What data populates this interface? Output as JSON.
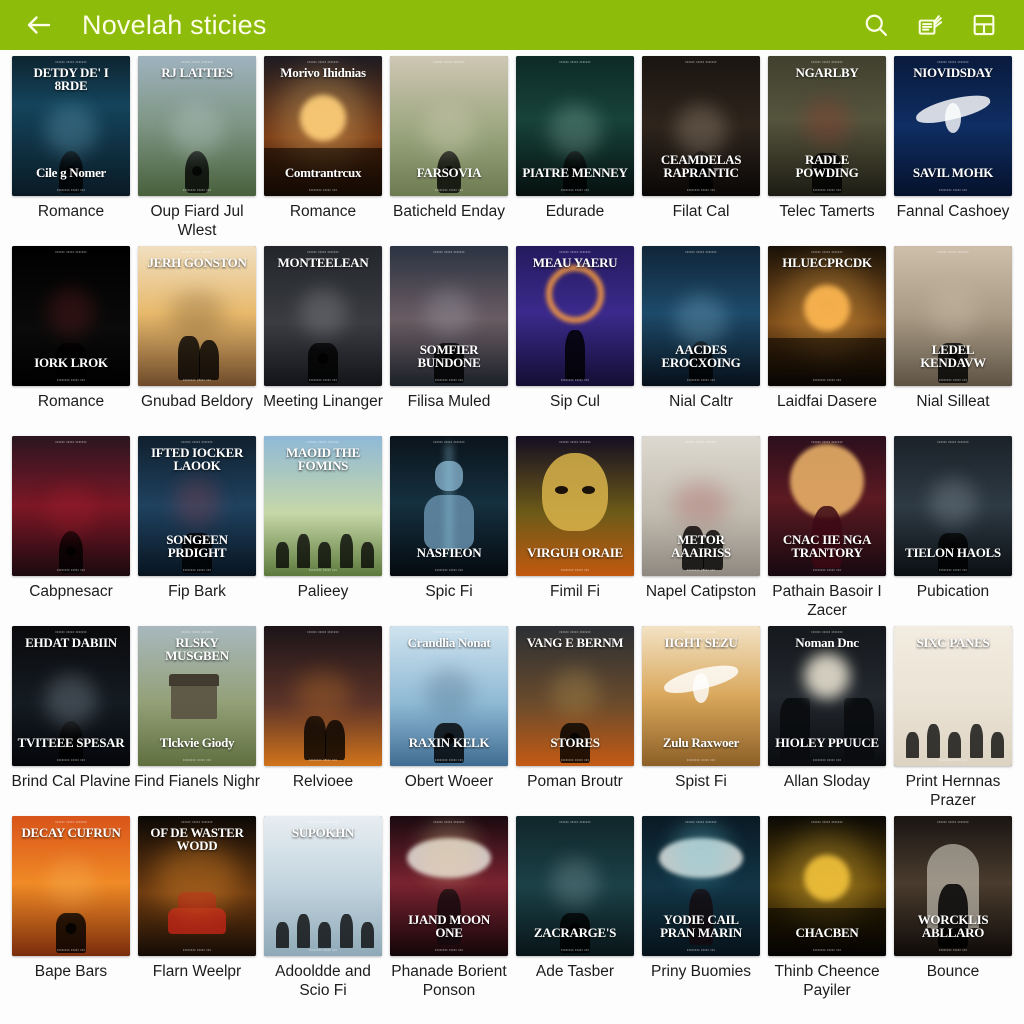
{
  "app_bar": {
    "back_icon": "arrow-left-icon",
    "title": "Novelah sticies",
    "actions": [
      {
        "name": "search-icon",
        "label": "Search"
      },
      {
        "name": "bookshelf-icon",
        "label": "Library"
      },
      {
        "name": "book-icon",
        "label": "Reader"
      }
    ],
    "background_color": "#8dbc0a",
    "title_color": "#fdfee8"
  },
  "grid": {
    "columns": 8,
    "rows": 5,
    "background_color": "#fdfdfd",
    "items": [
      {
        "label": "Romance",
        "cover_title_top": "DETDY DE' I 8RDE",
        "cover_title_bottom": "Cile g Nomer",
        "bg": "linear-gradient(180deg,#0d2430 0%,#14445c 35%,#0a1a24 100%)",
        "accent": "#8fd4f0",
        "figure": "woman"
      },
      {
        "label": "Oup Fiard Jul Wlest",
        "cover_title_top": "RJ LATTIES",
        "cover_title_bottom": "",
        "bg": "linear-gradient(180deg,#9fb3bf 0%,#7e9685 48%,#49603c 100%)",
        "accent": "#d8e5ea",
        "figure": "woman"
      },
      {
        "label": "Romance",
        "cover_title_top": "Morivo Ihidnіas",
        "cover_title_bottom": "Comtrantrcux",
        "bg": "linear-gradient(180deg,#1d1b22 0%,#7a3c16 58%,#2a1508 100%)",
        "accent": "#ffd07a",
        "figure": "sun"
      },
      {
        "label": "Baticheld Enday",
        "cover_title_top": "",
        "cover_title_bottom": "FARSOVIA",
        "bg": "linear-gradient(180deg,#cfc7b4 0%,#9aa57e 55%,#6d7b51 100%)",
        "accent": "#e8e2cf",
        "figure": "woman"
      },
      {
        "label": "Edurade",
        "cover_title_top": "",
        "cover_title_bottom": "PIATRE MENNEY",
        "bg": "linear-gradient(180deg,#0e2a26 0%,#17433a 45%,#06100f 100%)",
        "accent": "#b6e3d4",
        "figure": "woman"
      },
      {
        "label": "Filat Cal",
        "cover_title_top": "",
        "cover_title_bottom": "CEAMDELAS RAPRANTIC",
        "bg": "linear-gradient(180deg,#1a1510 0%,#2e241c 50%,#090706 100%)",
        "accent": "#e3cdb4",
        "figure": "woman"
      },
      {
        "label": "Telec Tamerts",
        "cover_title_top": "NGARLBY",
        "cover_title_bottom": "RADLE POWDING",
        "bg": "linear-gradient(180deg,#41402f 0%,#55553d 45%,#1d1c14 100%)",
        "accent": "#c3302c",
        "figure": "man"
      },
      {
        "label": "Fannal Cashoey",
        "cover_title_top": "NIOVIDSDAY",
        "cover_title_bottom": "SAVIL MOHK",
        "bg": "linear-gradient(180deg,#091a3d 0%,#0f2e63 50%,#05112b 100%)",
        "accent": "#e8c349",
        "figure": "bird"
      },
      {
        "label": "Romance",
        "cover_title_top": "",
        "cover_title_bottom": "IORK LROK",
        "bg": "linear-gradient(180deg,#000000 0%,#0a0a0a 60%,#000000 100%)",
        "accent": "#b83235",
        "figure": "man"
      },
      {
        "label": "Gnubad Beldory",
        "cover_title_top": "JERH GONSTON",
        "cover_title_bottom": "",
        "bg": "linear-gradient(180deg,#f0dfc0 0%,#e8b96c 48%,#6d4a2a 100%)",
        "accent": "#3a2a18",
        "figure": "couple"
      },
      {
        "label": "Meeting Linanger",
        "cover_title_top": "MONTEELEAN",
        "cover_title_bottom": "",
        "bg": "linear-gradient(180deg,#23262b 0%,#3a3c42 55%,#121418 100%)",
        "accent": "#d9d9d9",
        "figure": "man"
      },
      {
        "label": "Filisa Muled",
        "cover_title_top": "",
        "cover_title_bottom": "SOMFIER BUNDONE",
        "bg": "linear-gradient(180deg,#2b3342 0%,#6a5c63 52%,#1b2028 100%)",
        "accent": "#cfd6e0",
        "figure": "man"
      },
      {
        "label": "Sip Cul",
        "cover_title_top": "MEAU YAERU",
        "cover_title_bottom": "",
        "bg": "linear-gradient(180deg,#241a5e 0%,#3b2a8c 48%,#130e33 100%)",
        "accent": "#ff9f3c",
        "figure": "magic"
      },
      {
        "label": "Nial Caltr",
        "cover_title_top": "",
        "cover_title_bottom": "AACDES EROCXOING",
        "bg": "linear-gradient(180deg,#102538 0%,#1d4a6a 48%,#071019 100%)",
        "accent": "#9fd6ef",
        "figure": "woman"
      },
      {
        "label": "Laidfai Dasere",
        "cover_title_top": "HLUECPRCDK",
        "cover_title_bottom": "",
        "bg": "linear-gradient(180deg,#1a1208 0%,#7a4a18 55%,#140c05 100%)",
        "accent": "#ffb851",
        "figure": "sun"
      },
      {
        "label": "Nial Silleat",
        "cover_title_top": "",
        "cover_title_bottom": "LEDEL KENDAVW",
        "bg": "linear-gradient(180deg,#cdbfa9 0%,#a99a85 50%,#5d5344 100%)",
        "accent": "#e4d8c4",
        "figure": "man"
      },
      {
        "label": "Cabpnesacr",
        "cover_title_top": "",
        "cover_title_bottom": "",
        "bg": "linear-gradient(180deg,#2a1620 0%,#7d1726 50%,#1a0a0f 100%)",
        "accent": "#b3202e",
        "figure": "woman"
      },
      {
        "label": "Fip Bark",
        "cover_title_top": "IFTED IOCKER LAOOK",
        "cover_title_bottom": "SONGEEN PRDIGHT",
        "bg": "linear-gradient(180deg,#10202e 0%,#1f4260 50%,#081420 100%)",
        "accent": "#d9434a",
        "figure": "man"
      },
      {
        "label": "Palieey",
        "cover_title_top": "MAOID THE FOMINS",
        "cover_title_bottom": "",
        "bg": "linear-gradient(180deg,#8fb9d8 0%,#c6d7a8 55%,#5d7a3c 100%)",
        "accent": "#e4453f",
        "figure": "crowd"
      },
      {
        "label": "Spic Fi",
        "cover_title_top": "",
        "cover_title_bottom": "NASFIEON",
        "bg": "linear-gradient(180deg,#0b141c 0%,#15303f 48%,#050a10 100%)",
        "accent": "#9fdcf2",
        "figure": "robot"
      },
      {
        "label": "Fimil Fi",
        "cover_title_top": "",
        "cover_title_bottom": "VIRGUH ORAIE",
        "bg": "linear-gradient(180deg,#140d22 0%,#6d5a18 55%,#c2590f 100%)",
        "accent": "#d9b44a",
        "figure": "face"
      },
      {
        "label": "Napel Catipston",
        "cover_title_top": "",
        "cover_title_bottom": "METOR AAAIRISS",
        "bg": "linear-gradient(180deg,#ddd9d0 0%,#c2bcb0 55%,#8e8880 100%)",
        "accent": "#9c2530",
        "figure": "couple"
      },
      {
        "label": "Pathain Basoir I Zacer",
        "cover_title_top": "",
        "cover_title_bottom": "CNAC IIE NGA TRANTORY",
        "bg": "linear-gradient(180deg,#2b0f1c 0%,#5c1a22 45%,#170810 100%)",
        "accent": "#f0b86b",
        "figure": "moon"
      },
      {
        "label": "Pubication",
        "cover_title_top": "",
        "cover_title_bottom": "TIELON HAOLS",
        "bg": "linear-gradient(180deg,#1b2229 0%,#2e3a44 50%,#0b0f13 100%)",
        "accent": "#d6e2ea",
        "figure": "man"
      },
      {
        "label": "Brind Cal Plavine",
        "cover_title_top": "EHDAT DABIIN",
        "cover_title_bottom": "TVITEEE SPESAR",
        "bg": "linear-gradient(180deg,#0a0a0c 0%,#141b22 55%,#05060a 100%)",
        "accent": "#c0d0dd",
        "figure": "woman"
      },
      {
        "label": "Find Fianels Nighr",
        "cover_title_top": "RLSKY MUSGBEN",
        "cover_title_bottom": "Tlckvie Giody",
        "bg": "linear-gradient(180deg,#a8b8be 0%,#93a077 55%,#5f6f3f 100%)",
        "accent": "#efeee4",
        "figure": "house"
      },
      {
        "label": "Relvioee",
        "cover_title_top": "",
        "cover_title_bottom": "",
        "bg": "linear-gradient(180deg,#1c1418 0%,#5b3328 55%,#d1741c 100%)",
        "accent": "#ff9a2c",
        "figure": "couple"
      },
      {
        "label": "Obert Woeer",
        "cover_title_top": "Crandlia Nonat",
        "cover_title_bottom": "RAXIN KELK",
        "bg": "linear-gradient(180deg,#cfe3ef 0%,#8fb9d4 55%,#3f6c92 100%)",
        "accent": "#1d3b55",
        "figure": "man"
      },
      {
        "label": "Poman Broutr",
        "cover_title_top": "VANG E BERNM",
        "cover_title_bottom": "STORES",
        "bg": "linear-gradient(180deg,#2b2f34 0%,#6a4b2c 55%,#c45a14 100%)",
        "accent": "#e8c86a",
        "figure": "man"
      },
      {
        "label": "Spist Fi",
        "cover_title_top": "IIGHT SEZU",
        "cover_title_bottom": "Zulu Raxwoer",
        "bg": "linear-gradient(180deg,#f3e2c4 0%,#d9a85c 50%,#8c5f27 100%)",
        "accent": "#4a3318",
        "figure": "bird"
      },
      {
        "label": "Allan Sloday",
        "cover_title_top": "Noman Dnc",
        "cover_title_bottom": "HIOLEY PPUUCE",
        "bg": "linear-gradient(180deg,#15181c 0%,#23282e 50%,#0a0c0f 100%)",
        "accent": "#f0ead8",
        "figure": "duel"
      },
      {
        "label": "Print Hernnas Prazer",
        "cover_title_top": "SIXC PANES",
        "cover_title_bottom": "",
        "bg": "linear-gradient(180deg,#f3ece0 0%,#eae2d4 55%,#ddd3c2 100%)",
        "accent": "#c42a24",
        "figure": "crowd"
      },
      {
        "label": "Bape Bars",
        "cover_title_top": "DECAY CUFRUN",
        "cover_title_bottom": "",
        "bg": "linear-gradient(180deg,#d9541a 0%,#f08a26 48%,#7a2c0c 100%)",
        "accent": "#ffd27a",
        "figure": "man"
      },
      {
        "label": "Flarn Weelpr",
        "cover_title_top": "OF DE WASTER WODD",
        "cover_title_bottom": "",
        "bg": "linear-gradient(180deg,#0b0806 0%,#6b3a10 55%,#140b05 100%)",
        "accent": "#ff9b2e",
        "figure": "car"
      },
      {
        "label": "Adooldde and Scio Fi",
        "cover_title_top": "SUPOKHN",
        "cover_title_bottom": "",
        "bg": "linear-gradient(180deg,#e8eef2 0%,#c2d4de 50%,#8fa9b8 100%)",
        "accent": "#2b3a45",
        "figure": "crowd"
      },
      {
        "label": "Phanade Borient Ponson",
        "cover_title_top": "",
        "cover_title_bottom": "IJAND MOON ONE",
        "bg": "linear-gradient(180deg,#1a0a10 0%,#7a2330 48%,#120508 100%)",
        "accent": "#f0d89a",
        "figure": "angel"
      },
      {
        "label": "Ade Tasber",
        "cover_title_top": "",
        "cover_title_bottom": "ZACRARGE'S",
        "bg": "linear-gradient(180deg,#10262b 0%,#1b4147 50%,#081418 100%)",
        "accent": "#cfe3e6",
        "figure": "man"
      },
      {
        "label": "Priny Buomies",
        "cover_title_top": "",
        "cover_title_bottom": "YODIE CAIL PRAN MARIN",
        "bg": "linear-gradient(180deg,#0a1a24 0%,#123546 50%,#06121a 100%)",
        "accent": "#6fd6ea",
        "figure": "angel"
      },
      {
        "label": "Thinb Cheence Payiler",
        "cover_title_top": "",
        "cover_title_bottom": "CHACBEN",
        "bg": "linear-gradient(180deg,#0a0906 0%,#5c4208 50%,#0a0805 100%)",
        "accent": "#f2c23c",
        "figure": "sun"
      },
      {
        "label": "Bounce",
        "cover_title_top": "",
        "cover_title_bottom": "WORCKLIS ABLLARO",
        "bg": "linear-gradient(180deg,#1a1512 0%,#4a3c2e 48%,#0e0a08 100%)",
        "accent": "#cdbfa6",
        "figure": "door"
      }
    ]
  }
}
